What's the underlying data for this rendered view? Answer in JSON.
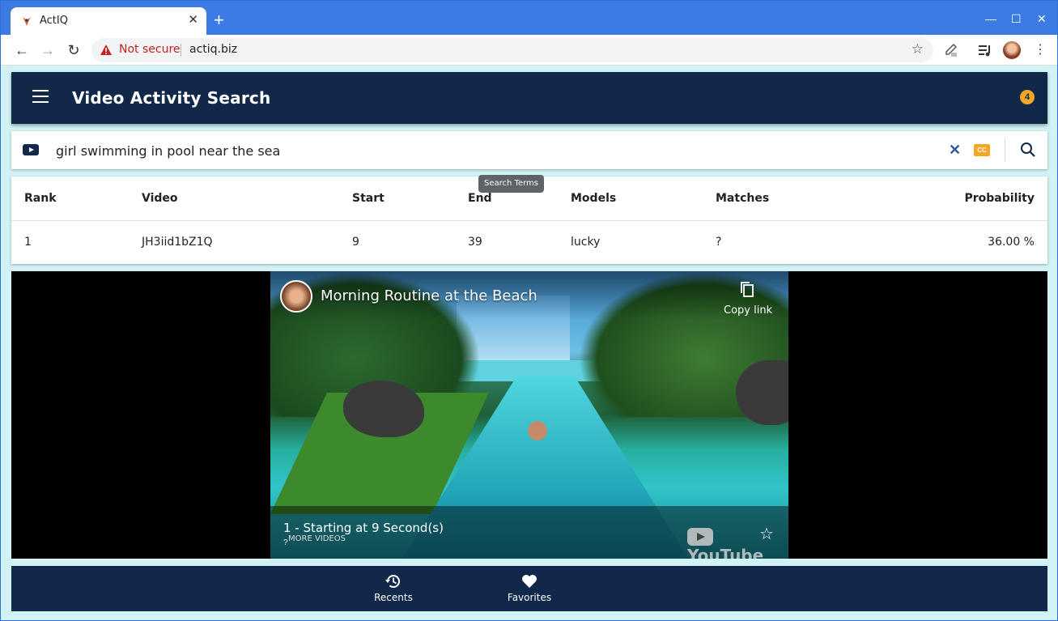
{
  "browser": {
    "tab_title": "ActIQ",
    "tab_close": "✕",
    "new_tab": "+",
    "security_label": "Not secure",
    "url": "actiq.biz"
  },
  "app": {
    "title": "Video Activity Search",
    "notification_count": "4"
  },
  "search": {
    "query": "girl swimming in pool near the sea",
    "tooltip": "Search Terms",
    "cc_label": "CC"
  },
  "results": {
    "columns": [
      "Rank",
      "Video",
      "Start",
      "End",
      "Models",
      "Matches",
      "Probability"
    ],
    "rows": [
      {
        "rank": "1",
        "video": "JH3iid1bZ1Q",
        "start": "9",
        "end": "39",
        "models": "lucky",
        "matches": "?",
        "probability": "36.00 %"
      }
    ]
  },
  "player": {
    "video_title": "Morning Routine at the Beach",
    "copy_link": "Copy link",
    "caption": "1 - Starting at 9 Second(s)",
    "more_videos": "MORE VIDEOS",
    "question": "?",
    "youtube_label": "YouTube"
  },
  "bottom_nav": {
    "items": [
      {
        "label": "Recents",
        "icon": "history-icon"
      },
      {
        "label": "Favorites",
        "icon": "heart-icon"
      }
    ]
  },
  "colors": {
    "appbar": "#12284b",
    "background": "#d1f3f5",
    "accent": "#f5a623",
    "browser_frame": "#3b7be3"
  }
}
